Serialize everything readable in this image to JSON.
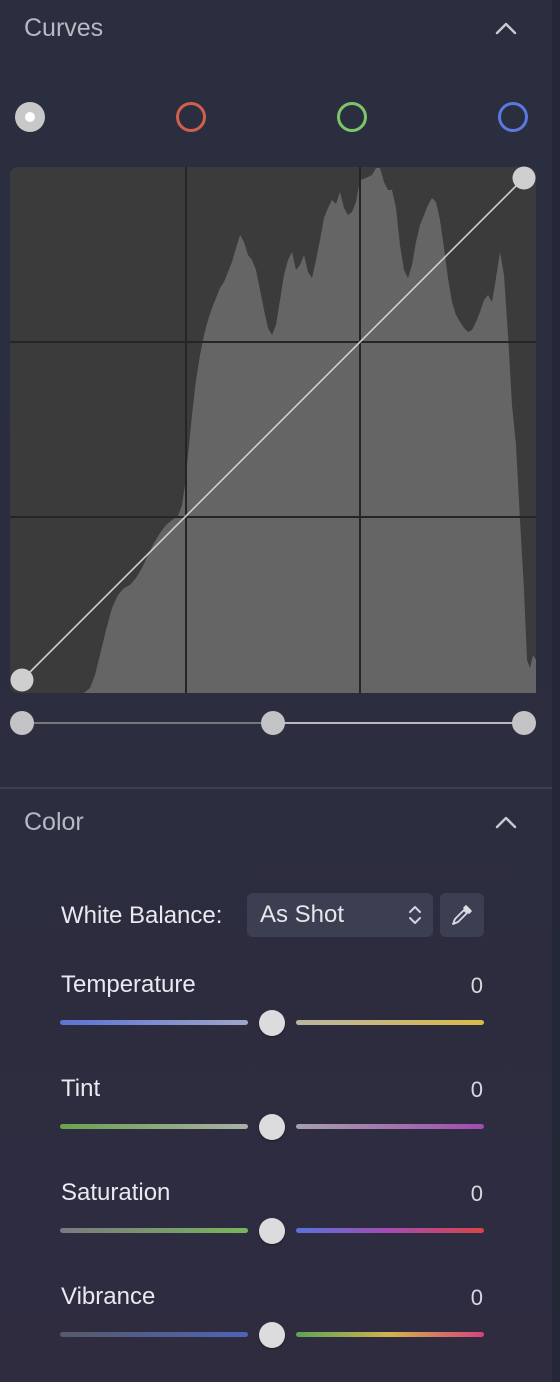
{
  "curves": {
    "title": "Curves",
    "channels": [
      {
        "name": "rgb",
        "color": "#c8c8c8"
      },
      {
        "name": "red",
        "color": "#d0604c"
      },
      {
        "name": "green",
        "color": "#7cc66a"
      },
      {
        "name": "blue",
        "color": "#5a78e0"
      }
    ],
    "histogram_color": "#656565",
    "graph_background": "#3b3b3b",
    "curve_points": [
      [
        0,
        0
      ],
      [
        1,
        1
      ]
    ],
    "range": {
      "black": 0,
      "mid": 0.5,
      "white": 1
    }
  },
  "color": {
    "title": "Color",
    "white_balance": {
      "label": "White Balance:",
      "value": "As Shot"
    },
    "sliders": [
      {
        "key": "temperature",
        "label": "Temperature",
        "value": "0",
        "left_gradient": [
          "#5d73d4",
          "#9ea6c9"
        ],
        "right_gradient": [
          "#b9b6a2",
          "#d9b94a"
        ]
      },
      {
        "key": "tint",
        "label": "Tint",
        "value": "0",
        "left_gradient": [
          "#6aa24e",
          "#a9b0a6"
        ],
        "right_gradient": [
          "#a5a0ab",
          "#a14bb0"
        ]
      },
      {
        "key": "saturation",
        "label": "Saturation",
        "value": "0",
        "left_gradient": [
          "#7a7a80",
          "#79b55a"
        ],
        "right_gradient": [
          "#5a72dc",
          "#a44cb0",
          "#d94545"
        ]
      },
      {
        "key": "vibrance",
        "label": "Vibrance",
        "value": "0",
        "left_gradient": [
          "#565a68",
          "#4d63b8"
        ],
        "right_gradient": [
          "#5ca35a",
          "#d2b44c",
          "#d6437a"
        ]
      }
    ]
  }
}
